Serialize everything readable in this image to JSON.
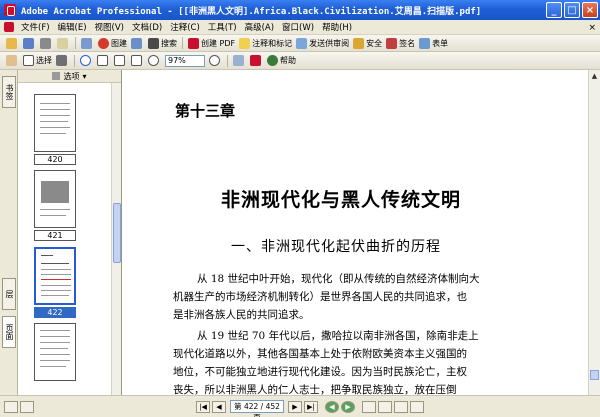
{
  "window": {
    "title": "Adobe Acrobat Professional - [[非洲黑人文明].Africa.Black.Civilization.艾周昌.扫描版.pdf]",
    "minimize": "_",
    "maximize": "□",
    "close": "×"
  },
  "menu": {
    "items": [
      "文件(F)",
      "编辑(E)",
      "视图(V)",
      "文档(D)",
      "注释(C)",
      "工具(T)",
      "高级(A)",
      "窗口(W)",
      "帮助(H)"
    ],
    "close_glyph": "×"
  },
  "toolbar1": {
    "print_label": "图建",
    "search_label": "搜索",
    "create_pdf_label": "创建 PDF",
    "comment_label": "注释和标记",
    "review_label": "发送供审阅",
    "secure_label": "安全",
    "sign_label": "签名",
    "forms_label": "表单"
  },
  "toolbar2": {
    "select_label": "选择",
    "zoom_value": "97%",
    "help_label": "帮助"
  },
  "nav": {
    "tab_bookmarks": "书签",
    "tab_pages": "页面",
    "tab_layers": "层"
  },
  "thumbnails": {
    "options_label": "选项",
    "items": [
      {
        "label": "420",
        "selected": false
      },
      {
        "label": "421",
        "selected": false
      },
      {
        "label": "422",
        "selected": true
      },
      {
        "label": "",
        "selected": false
      }
    ]
  },
  "document": {
    "chapter": "第十三章",
    "title": "非洲现代化与黑人传统文明",
    "section": "一、非洲现代化起伏曲折的历程",
    "lines": [
      "从 18 世纪中叶开始，现代化（即从传统的自然经济体制向大",
      "机器生产的市场经济机制转化）是世界各国人民的共同追求，也",
      "是非洲各族人民的共同追求。",
      "从 19 世纪 70 年代以后，撒哈拉以南非洲各国，除南非走上",
      "现代化道路以外，其他各国基本上处于依附欧美资本主义强国的",
      "地位，不可能独立地进行现代化建设。因为当时民族沦亡，主权",
      "丧失，所以非洲黑人的仁人志士，把争取民族独立，放在压倒"
    ]
  },
  "status": {
    "page_indicator": "第 422 / 452 页"
  },
  "colors": {
    "titlebar": "#1f5fd6",
    "selection": "#316ac5"
  }
}
